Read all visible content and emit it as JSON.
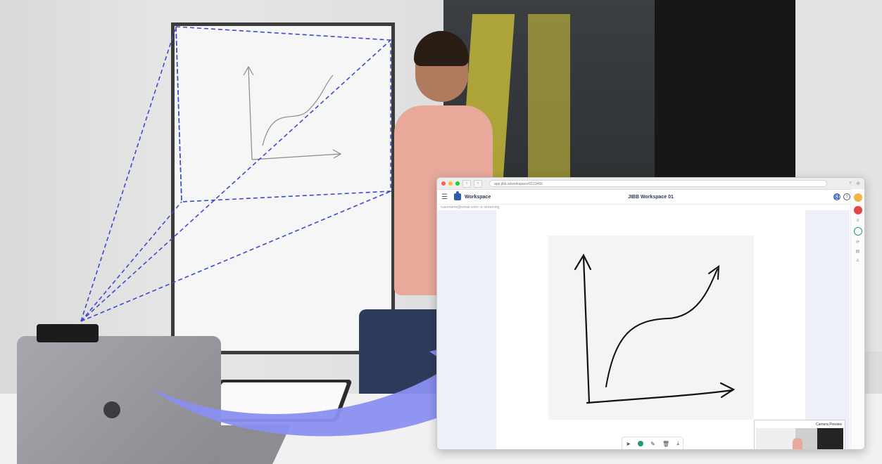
{
  "browser": {
    "url": "app.jibb.ai/workspace/0123456",
    "back_icon": "chevron-left-icon",
    "forward_icon": "chevron-right-icon",
    "right_controls": [
      "+",
      "⊕"
    ]
  },
  "app": {
    "menu_icon": "hamburger-icon",
    "brand_label": "Workspace",
    "workspace_title": "JIBB Workspace 01",
    "subline": "<username@email.com> is streaming",
    "top_icons": [
      "accessibility-icon",
      "help-icon",
      "account-icon"
    ]
  },
  "toolbar": {
    "tools": [
      "cursor",
      "color",
      "pen",
      "delete",
      "download"
    ]
  },
  "camera_preview": {
    "title": "Camera Preview"
  },
  "colors": {
    "accent": "#2f5ca8",
    "arrow": "#8a8ff0",
    "dashed": "#3b4ccf",
    "green": "#1e9e6e",
    "red": "#e04848",
    "orange": "#f2b346"
  }
}
